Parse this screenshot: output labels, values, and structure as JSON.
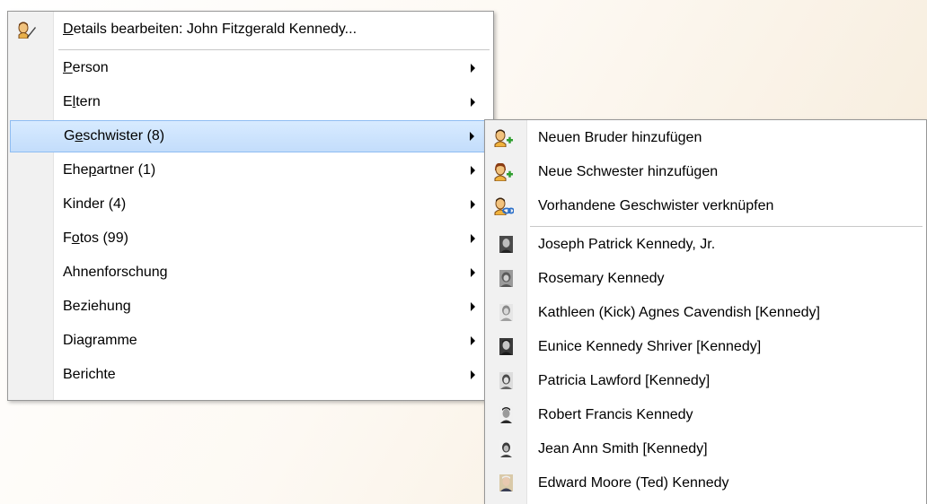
{
  "main_menu": {
    "items": [
      {
        "id": "details",
        "pre": "",
        "acc": "D",
        "post": "etails bearbeiten: John Fitzgerald Kennedy...",
        "has_submenu": false
      },
      {
        "id": "person",
        "pre": "",
        "acc": "P",
        "post": "erson",
        "has_submenu": true
      },
      {
        "id": "eltern",
        "pre": "E",
        "acc": "l",
        "post": "tern",
        "has_submenu": true
      },
      {
        "id": "geschwister",
        "pre": "G",
        "acc": "e",
        "post": "schwister (8)",
        "has_submenu": true,
        "highlighted": true
      },
      {
        "id": "ehepartner",
        "pre": "Ehe",
        "acc": "p",
        "post": "artner (1)",
        "has_submenu": true
      },
      {
        "id": "kinder",
        "pre": "Kinder (4)",
        "acc": "",
        "post": "",
        "has_submenu": true
      },
      {
        "id": "fotos",
        "pre": "F",
        "acc": "o",
        "post": "tos (99)",
        "has_submenu": true
      },
      {
        "id": "ahnenforschung",
        "pre": "Ahnenforschung",
        "acc": "",
        "post": "",
        "has_submenu": true
      },
      {
        "id": "beziehung",
        "pre": "Beziehung",
        "acc": "",
        "post": "",
        "has_submenu": true
      },
      {
        "id": "diagramme",
        "pre": "Diagramme",
        "acc": "",
        "post": "",
        "has_submenu": true
      },
      {
        "id": "berichte",
        "pre": "Berichte",
        "acc": "",
        "post": "",
        "has_submenu": true
      }
    ]
  },
  "siblings_submenu": {
    "actions": [
      {
        "label": "Neuen Bruder hinzufügen",
        "icon": "add-brother-icon"
      },
      {
        "label": "Neue Schwester hinzufügen",
        "icon": "add-sister-icon"
      },
      {
        "label": "Vorhandene Geschwister verknüpfen",
        "icon": "link-siblings-icon"
      }
    ],
    "siblings": [
      {
        "label": "Joseph Patrick Kennedy, Jr.",
        "icon": "photo-icon"
      },
      {
        "label": "Rosemary Kennedy",
        "icon": "photo-icon"
      },
      {
        "label": "Kathleen (Kick) Agnes Cavendish [Kennedy]",
        "icon": "photo-icon"
      },
      {
        "label": "Eunice Kennedy Shriver [Kennedy]",
        "icon": "photo-icon"
      },
      {
        "label": "Patricia Lawford [Kennedy]",
        "icon": "photo-icon"
      },
      {
        "label": "Robert Francis Kennedy",
        "icon": "photo-icon"
      },
      {
        "label": "Jean Ann Smith [Kennedy]",
        "icon": "photo-icon"
      },
      {
        "label": "Edward Moore (Ted) Kennedy",
        "icon": "photo-icon"
      }
    ]
  },
  "colors": {
    "highlight": "#cce4ff",
    "highlight_border": "#8fbdf2",
    "menu_border": "#979797"
  }
}
